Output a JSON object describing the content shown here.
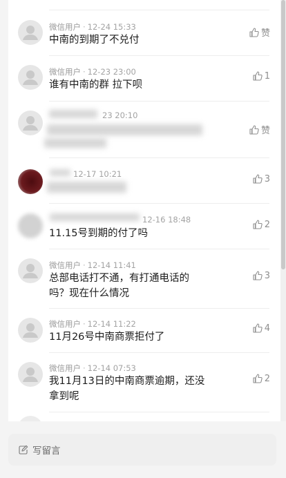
{
  "comments": [
    {
      "author": "微信用户",
      "time": "12-24 15:33",
      "text": "中南的到期了不兑付",
      "likes": "赞"
    },
    {
      "author": "微信用户",
      "time": "12-23 23:00",
      "text": "谁有中南的群 拉下呗",
      "likes": "1"
    },
    {
      "author": "",
      "time": "23 20:10",
      "text": "",
      "likes": "赞"
    },
    {
      "author": "",
      "time": "12-17 10:21",
      "text": "",
      "likes": "3"
    },
    {
      "author": "",
      "time": "12-16 18:48",
      "text": "11.15号到期的付了吗",
      "likes": "2"
    },
    {
      "author": "微信用户",
      "time": "12-14 11:41",
      "text": "总部电话打不通，有打通电话的吗？现在什么情况",
      "likes": "3"
    },
    {
      "author": "微信用户",
      "time": "12-14 11:22",
      "text": "11月26号中南商票拒付了",
      "likes": "4"
    },
    {
      "author": "微信用户",
      "time": "12-14 07:53",
      "text": "我11月13日的中南商票逾期，还没拿到呢",
      "likes": "2"
    }
  ],
  "footer": {
    "write_label": "写留言",
    "icon": "pencil-icon"
  },
  "icons": {
    "like": "thumbs-up-icon",
    "avatar": "default-user-icon"
  },
  "colors": {
    "meta": "#9a9a9a",
    "text": "#1c1c1c",
    "bottom_bar": "#efefef"
  }
}
